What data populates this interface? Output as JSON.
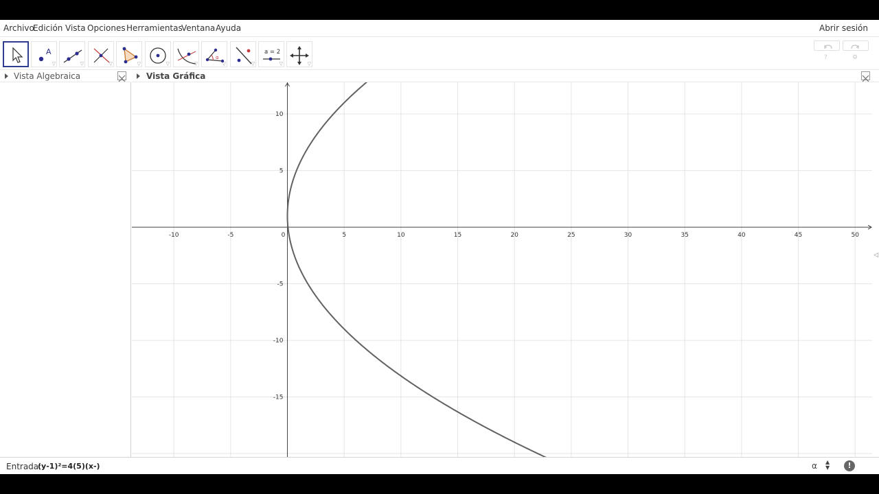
{
  "menu": {
    "items": [
      "Archivo",
      "Edición",
      "Vista",
      "Opciones",
      "Herramientas",
      "Ventana",
      "Ayuda"
    ],
    "login_label": "Abrir sesión"
  },
  "toolbar": {
    "tools": [
      {
        "name": "move-tool",
        "icon": "arrow-cursor-icon",
        "selected": true
      },
      {
        "name": "point-tool",
        "icon": "point-a-icon"
      },
      {
        "name": "line-tool",
        "icon": "line-through-points-icon"
      },
      {
        "name": "perpendicular-tool",
        "icon": "perpendicular-line-icon"
      },
      {
        "name": "polygon-tool",
        "icon": "polygon-icon"
      },
      {
        "name": "circle-tool",
        "icon": "circle-center-icon"
      },
      {
        "name": "conic-tool",
        "icon": "parabola-icon"
      },
      {
        "name": "angle-tool",
        "icon": "angle-icon"
      },
      {
        "name": "reflect-tool",
        "icon": "reflect-icon"
      },
      {
        "name": "slider-tool",
        "icon": "slider-icon",
        "label": "a = 2"
      },
      {
        "name": "move-view-tool",
        "icon": "move-view-icon"
      }
    ]
  },
  "panels": {
    "algebra_title": "Vista Algebraica",
    "graphics_title": "Vista Gráfica"
  },
  "graph": {
    "x_ticks": [
      "-10",
      "-5",
      "0",
      "5",
      "10",
      "15",
      "20",
      "25",
      "30",
      "35",
      "40",
      "45",
      "50"
    ],
    "y_ticks": [
      "10",
      "5",
      "-5",
      "-10",
      "-15"
    ],
    "xlim": [
      -13.7,
      51.5
    ],
    "ylim": [
      -20.3,
      12.8
    ],
    "curve": {
      "type": "parabola",
      "equation": "(y-1)^2 = 20x",
      "vertex": [
        0,
        1
      ],
      "color": "#616161"
    }
  },
  "input": {
    "label": "Entrada:",
    "value": "(y-1)²=4(5)(x-)",
    "alpha_label": "α",
    "help_label": "!"
  },
  "colors": {
    "selected_tool_border": "#2e3d8f",
    "axis": "#444444",
    "grid": "#e5e5e5"
  }
}
